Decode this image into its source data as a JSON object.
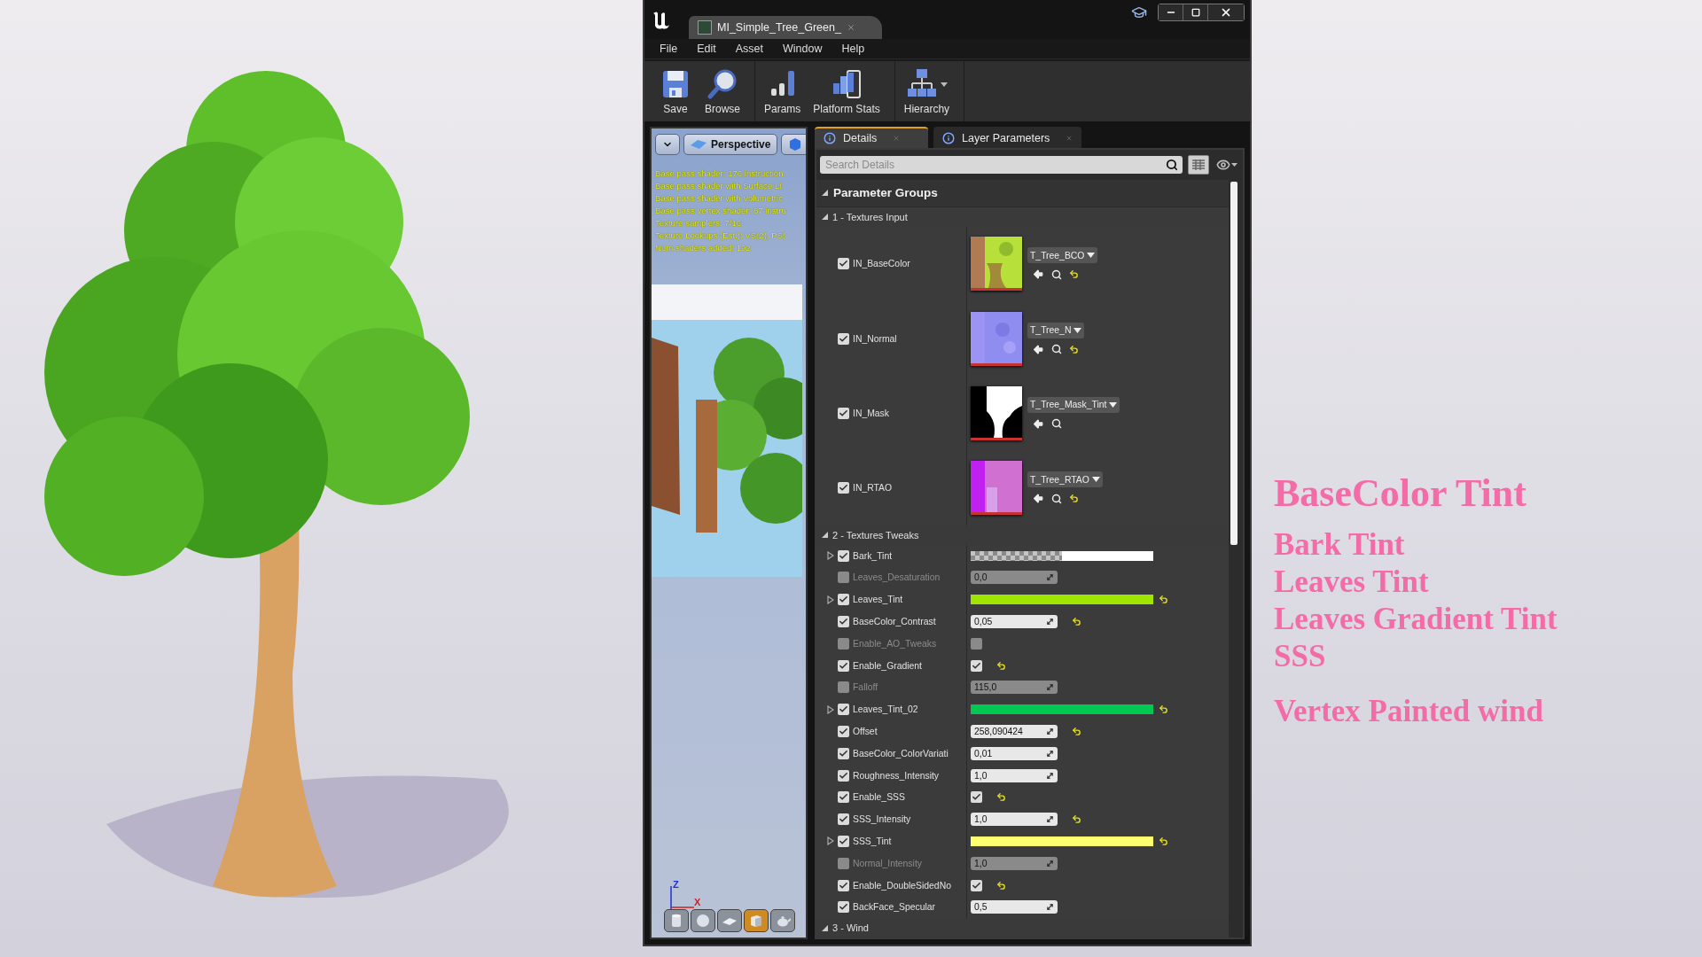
{
  "window": {
    "tab_title": "MI_Simple_Tree_Green_",
    "menu": [
      "File",
      "Edit",
      "Asset",
      "Window",
      "Help"
    ],
    "toolbar_groups": [
      [
        {
          "kind": "save",
          "label": "Save"
        },
        {
          "kind": "browse",
          "label": "Browse"
        }
      ],
      [
        {
          "kind": "params",
          "label": "Params"
        },
        {
          "kind": "platform",
          "label": "Platform Stats"
        }
      ],
      [
        {
          "kind": "hierarchy",
          "label": "Hierarchy",
          "dropdown": true
        }
      ]
    ]
  },
  "viewport": {
    "view_mode": "Perspective",
    "stats": [
      "Base pass shader: 176 instruction",
      "Base pass shader with Surface Li",
      "Base pass shader with Volumetric",
      "Base pass vertex shader: 87 instru",
      "Texture samplers: 7/16",
      "Texture Lookups (Est.): VS(2), PS(",
      "Num shaders added: 192"
    ],
    "axis_labels": [
      "Z",
      "X"
    ],
    "preview_shapes": [
      {
        "kind": "cylinder",
        "selected": false
      },
      {
        "kind": "sphere",
        "selected": false
      },
      {
        "kind": "plane",
        "selected": false
      },
      {
        "kind": "cube",
        "selected": true
      },
      {
        "kind": "teapot",
        "selected": false
      }
    ]
  },
  "details": {
    "tabs": [
      {
        "label": "Details",
        "selected": true
      },
      {
        "label": "Layer Parameters",
        "selected": false
      }
    ],
    "search": {
      "placeholder": "Search Details"
    },
    "header": "Parameter Groups",
    "groups": [
      {
        "title": "1 - Textures Input",
        "expanded": true,
        "params": [
          {
            "kind": "texture",
            "name": "IN_BaseColor",
            "checked": true,
            "asset": "T_Tree_BCO",
            "reset": true
          },
          {
            "kind": "texture",
            "name": "IN_Normal",
            "checked": true,
            "asset": "T_Tree_N",
            "reset": true
          },
          {
            "kind": "texture",
            "name": "IN_Mask",
            "checked": true,
            "asset": "T_Tree_Mask_Tint",
            "reset": false
          },
          {
            "kind": "texture",
            "name": "IN_RTAO",
            "checked": true,
            "asset": "T_Tree_RTAO",
            "reset": true
          }
        ]
      },
      {
        "title": "2 - Textures Tweaks",
        "expanded": true,
        "params": [
          {
            "kind": "color",
            "name": "Bark_Tint",
            "checked": true,
            "color": "#ffffff",
            "alpha_preview": true,
            "reset": false
          },
          {
            "kind": "scalar",
            "name": "Leaves_Desaturation",
            "checked": false,
            "value": "0,0",
            "reset": false
          },
          {
            "kind": "color",
            "name": "Leaves_Tint",
            "checked": true,
            "color": "#9ee600",
            "alpha_preview": false,
            "reset": true
          },
          {
            "kind": "scalar",
            "name": "BaseColor_Contrast",
            "checked": true,
            "value": "0,05",
            "reset": true
          },
          {
            "kind": "bool",
            "name": "Enable_AO_Tweaks",
            "checked": false,
            "on": false,
            "reset": false
          },
          {
            "kind": "bool",
            "name": "Enable_Gradient",
            "checked": true,
            "on": true,
            "reset": true
          },
          {
            "kind": "scalar",
            "name": "Falloff",
            "checked": false,
            "value": "115,0",
            "reset": false
          },
          {
            "kind": "color",
            "name": "Leaves_Tint_02",
            "checked": true,
            "color": "#00c853",
            "alpha_preview": false,
            "reset": true
          },
          {
            "kind": "scalar",
            "name": "Offset",
            "checked": true,
            "value": "258,090424",
            "reset": true
          },
          {
            "kind": "scalar",
            "name": "BaseColor_ColorVariati",
            "checked": true,
            "value": "0,01",
            "reset": false
          },
          {
            "kind": "scalar",
            "name": "Roughness_Intensity",
            "checked": true,
            "value": "1,0",
            "reset": false
          },
          {
            "kind": "bool",
            "name": "Enable_SSS",
            "checked": true,
            "on": true,
            "reset": true
          },
          {
            "kind": "scalar",
            "name": "SSS_Intensity",
            "checked": true,
            "value": "1,0",
            "reset": true
          },
          {
            "kind": "color",
            "name": "SSS_Tint",
            "checked": true,
            "color": "#ffff70",
            "alpha_preview": false,
            "reset": true
          },
          {
            "kind": "scalar",
            "name": "Normal_Intensity",
            "checked": false,
            "value": "1,0",
            "reset": false
          },
          {
            "kind": "bool",
            "name": "Enable_DoubleSidedNo",
            "checked": true,
            "on": true,
            "reset": true
          },
          {
            "kind": "scalar",
            "name": "BackFace_Specular",
            "checked": true,
            "value": "0,5",
            "reset": false
          }
        ]
      },
      {
        "title": "3 - Wind",
        "expanded": true
      }
    ]
  },
  "captions": [
    {
      "kind": "heading",
      "text": "BaseColor Tint"
    },
    {
      "kind": "item",
      "text": "Bark Tint"
    },
    {
      "kind": "item",
      "text": "Leaves Tint"
    },
    {
      "kind": "item",
      "text": "Leaves Gradient Tint"
    },
    {
      "kind": "item",
      "text": "SSS"
    },
    {
      "kind": "footer",
      "text": "Vertex Painted wind"
    }
  ]
}
